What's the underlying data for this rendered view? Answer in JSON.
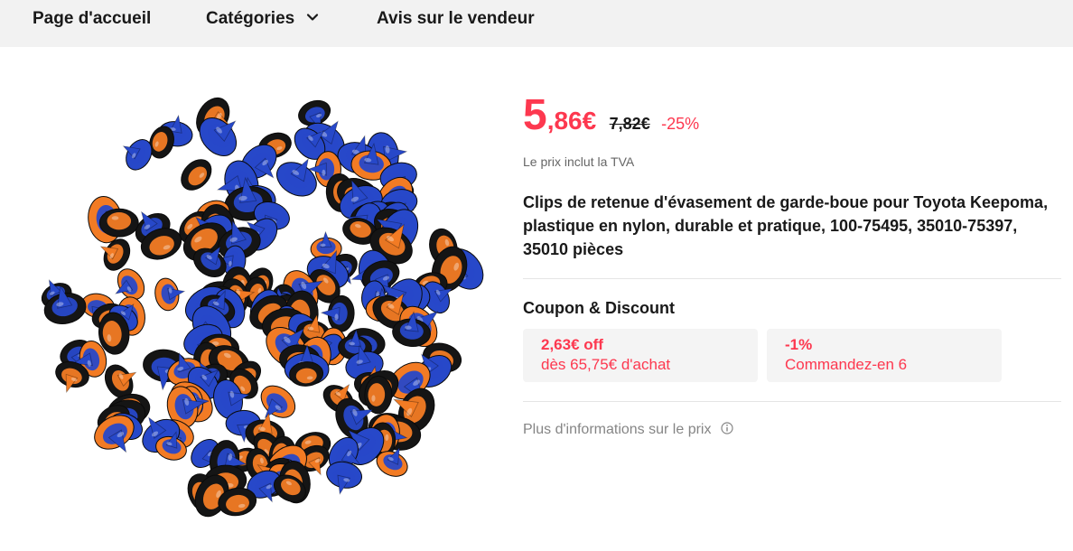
{
  "nav": {
    "home": "Page d'accueil",
    "categories": "Catégories",
    "seller_reviews": "Avis sur le vendeur"
  },
  "product": {
    "price_integer": "5",
    "price_decimal": ",86€",
    "original_price": "7,82€",
    "discount": "-25%",
    "vat_note": "Le prix inclut la TVA",
    "title": "Clips de retenue d'évasement de garde-boue pour Toyota Keepoma, plastique en nylon, durable et pratique, 100-75495, 35010-75397, 35010 pièces"
  },
  "coupons": {
    "heading": "Coupon & Discount",
    "items": [
      {
        "amount": "2,63€ off",
        "condition": "dès 65,75€ d'achat"
      },
      {
        "amount": "-1%",
        "condition": "Commandez-en 6"
      }
    ]
  },
  "more_info": "Plus d'informations sur le prix",
  "colors": {
    "accent": "#fd384f",
    "nav_bg": "#f2f2f2",
    "clip_orange": "#f27b24",
    "clip_blue": "#2748c9",
    "clip_black": "#151515"
  },
  "icons": {
    "categories_chevron": "chevron-down-icon",
    "info": "info-icon"
  }
}
